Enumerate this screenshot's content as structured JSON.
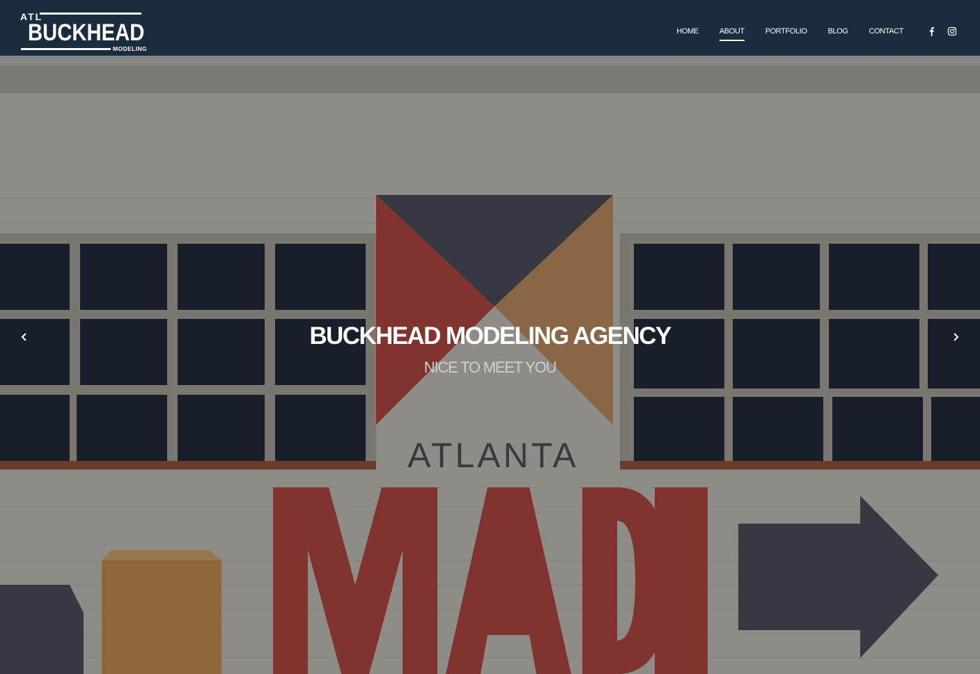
{
  "logo": {
    "prefix": "ATL",
    "name": "BUCKHEAD",
    "suffix": "MODELING"
  },
  "nav": {
    "items": [
      {
        "label": "HOME",
        "active": false
      },
      {
        "label": "ABOUT",
        "active": true
      },
      {
        "label": "PORTFOLIO",
        "active": false
      },
      {
        "label": "BLOG",
        "active": false
      },
      {
        "label": "CONTACT",
        "active": false
      }
    ]
  },
  "social": {
    "icons": [
      "facebook-icon",
      "instagram-icon"
    ]
  },
  "hero": {
    "title": "BUCKHEAD MODELING AGENCY",
    "subtitle": "NICE TO MEET YOU",
    "mural_word_top": "ATLANTA",
    "mural_word_main": "MADE",
    "prev_icon": "chevron-left-icon",
    "next_icon": "chevron-right-icon"
  },
  "colors": {
    "sky": "#1d3a52",
    "wall": "#d9d5c8",
    "mural_red": "#c2463a",
    "mural_tan": "#d29a5c",
    "mural_dark": "#4b5056",
    "text": "#ffffff"
  }
}
